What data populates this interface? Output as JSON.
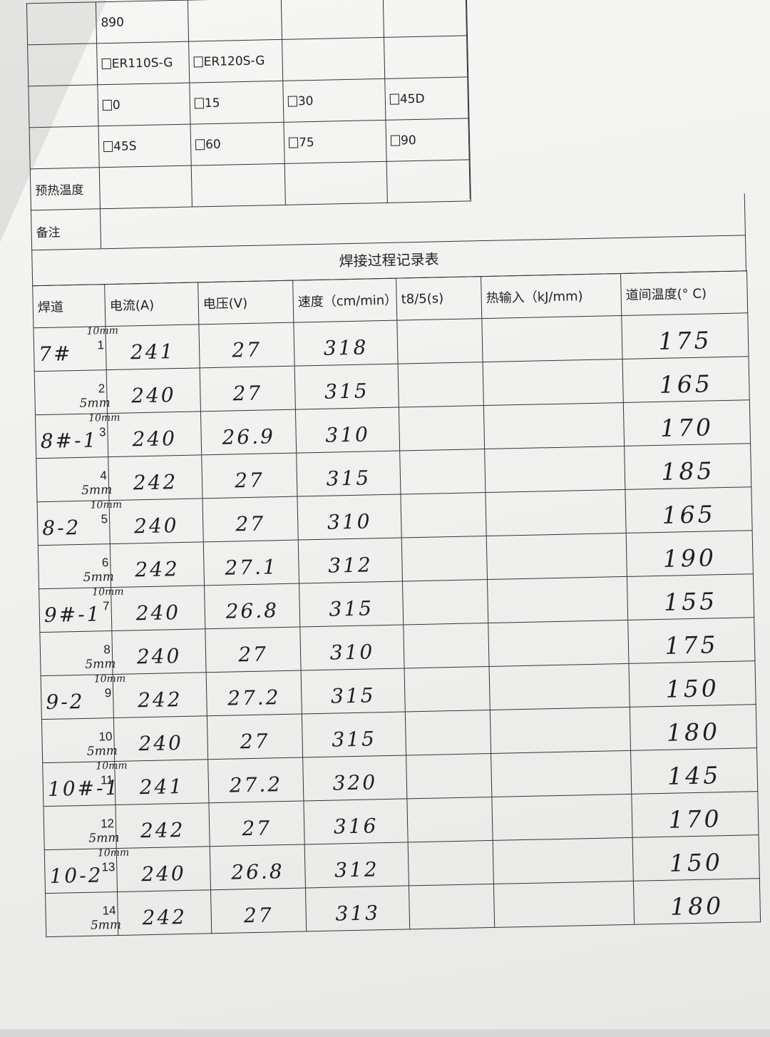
{
  "upper_table": {
    "row_a_code": "890",
    "filler_options": [
      "ER110S-G",
      "ER120S-G"
    ],
    "angle_options_row1": [
      "0",
      "15",
      "30",
      "45D"
    ],
    "angle_options_row2": [
      "45S",
      "60",
      "75",
      "90"
    ],
    "preheat_label": "预热温度",
    "remarks_label": "备注"
  },
  "process_table": {
    "title": "焊接过程记录表",
    "headers": [
      "焊道",
      "电流(A)",
      "电压(V)",
      "速度（cm/min）",
      "t8/5(s)",
      "热输入（kJ/mm)",
      "道间温度(° C)"
    ],
    "rows": [
      {
        "segment": "7#",
        "mm_top": "10mm",
        "mm_bottom": "",
        "pass": "1",
        "current": "241",
        "voltage": "27",
        "speed": "318",
        "t85": "",
        "heat_input": "",
        "interpass_temp": "175"
      },
      {
        "segment": "",
        "mm_top": "",
        "mm_bottom": "5mm",
        "pass": "2",
        "current": "240",
        "voltage": "27",
        "speed": "315",
        "t85": "",
        "heat_input": "",
        "interpass_temp": "165"
      },
      {
        "segment": "8#-1",
        "mm_top": "10mm",
        "mm_bottom": "",
        "pass": "3",
        "current": "240",
        "voltage": "26.9",
        "speed": "310",
        "t85": "",
        "heat_input": "",
        "interpass_temp": "170"
      },
      {
        "segment": "",
        "mm_top": "",
        "mm_bottom": "5mm",
        "pass": "4",
        "current": "242",
        "voltage": "27",
        "speed": "315",
        "t85": "",
        "heat_input": "",
        "interpass_temp": "185"
      },
      {
        "segment": "8-2",
        "mm_top": "10mm",
        "mm_bottom": "",
        "pass": "5",
        "current": "240",
        "voltage": "27",
        "speed": "310",
        "t85": "",
        "heat_input": "",
        "interpass_temp": "165"
      },
      {
        "segment": "",
        "mm_top": "",
        "mm_bottom": "5mm",
        "pass": "6",
        "current": "242",
        "voltage": "27.1",
        "speed": "312",
        "t85": "",
        "heat_input": "",
        "interpass_temp": "190"
      },
      {
        "segment": "9#-1",
        "mm_top": "10mm",
        "mm_bottom": "",
        "pass": "7",
        "current": "240",
        "voltage": "26.8",
        "speed": "315",
        "t85": "",
        "heat_input": "",
        "interpass_temp": "155"
      },
      {
        "segment": "",
        "mm_top": "",
        "mm_bottom": "5mm",
        "pass": "8",
        "current": "240",
        "voltage": "27",
        "speed": "310",
        "t85": "",
        "heat_input": "",
        "interpass_temp": "175"
      },
      {
        "segment": "9-2",
        "mm_top": "10mm",
        "mm_bottom": "",
        "pass": "9",
        "current": "242",
        "voltage": "27.2",
        "speed": "315",
        "t85": "",
        "heat_input": "",
        "interpass_temp": "150"
      },
      {
        "segment": "",
        "mm_top": "",
        "mm_bottom": "5mm",
        "pass": "10",
        "current": "240",
        "voltage": "27",
        "speed": "315",
        "t85": "",
        "heat_input": "",
        "interpass_temp": "180"
      },
      {
        "segment": "10#-1",
        "mm_top": "10mm",
        "mm_bottom": "",
        "pass": "11",
        "current": "241",
        "voltage": "27.2",
        "speed": "320",
        "t85": "",
        "heat_input": "",
        "interpass_temp": "145"
      },
      {
        "segment": "",
        "mm_top": "",
        "mm_bottom": "5mm",
        "pass": "12",
        "current": "242",
        "voltage": "27",
        "speed": "316",
        "t85": "",
        "heat_input": "",
        "interpass_temp": "170"
      },
      {
        "segment": "10-2",
        "mm_top": "10mm",
        "mm_bottom": "",
        "pass": "13",
        "current": "240",
        "voltage": "26.8",
        "speed": "312",
        "t85": "",
        "heat_input": "",
        "interpass_temp": "150"
      },
      {
        "segment": "",
        "mm_top": "",
        "mm_bottom": "5mm",
        "pass": "14",
        "current": "242",
        "voltage": "27",
        "speed": "313",
        "t85": "",
        "heat_input": "",
        "interpass_temp": "180"
      }
    ]
  }
}
